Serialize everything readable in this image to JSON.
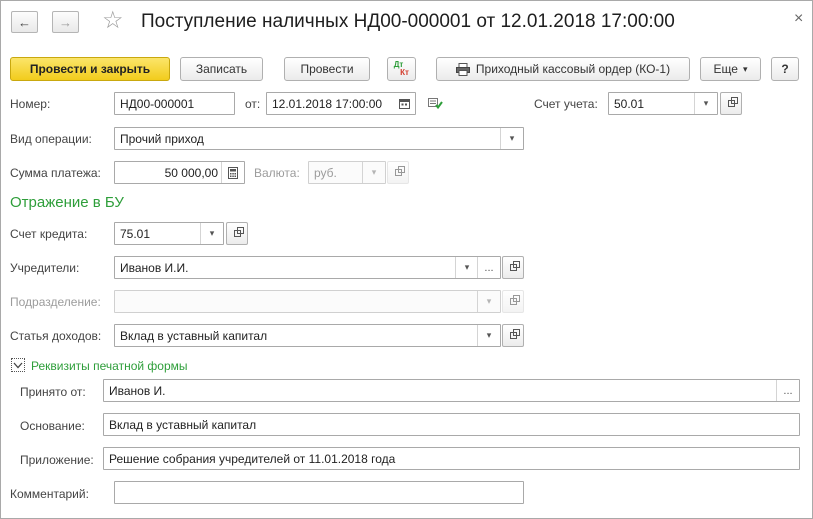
{
  "window": {
    "title": "Поступление наличных НД00-000001 от 12.01.2018 17:00:00",
    "close_glyph": "×"
  },
  "nav": {
    "back": "←",
    "forward": "→",
    "star": "☆"
  },
  "toolbar": {
    "post_close": "Провести и закрыть",
    "save": "Записать",
    "post": "Провести",
    "dt_kt_top": "Дт",
    "dt_kt_bottom": "Кт",
    "print_order": "Приходный кассовый ордер (КО-1)",
    "more": "Еще",
    "more_arrow": "▾",
    "help": "?"
  },
  "form": {
    "number_label": "Номер:",
    "number_value": "НД00-000001",
    "date_label": "от:",
    "date_value": "12.01.2018 17:00:00",
    "account_label": "Счет учета:",
    "account_value": "50.01",
    "operation_label": "Вид операции:",
    "operation_value": "Прочий приход",
    "amount_label": "Сумма платежа:",
    "amount_value": "50 000,00",
    "currency_label": "Валюта:",
    "currency_value": "руб."
  },
  "bu_section": {
    "title": "Отражение в БУ",
    "credit_account_label": "Счет кредита:",
    "credit_account_value": "75.01",
    "founders_label": "Учредители:",
    "founders_value": "Иванов И.И.",
    "division_label": "Подразделение:",
    "division_value": "",
    "income_item_label": "Статья доходов:",
    "income_item_value": "Вклад в уставный капитал"
  },
  "print_section": {
    "title": "Реквизиты печатной формы",
    "received_from_label": "Принято от:",
    "received_from_value": "Иванов И.",
    "basis_label": "Основание:",
    "basis_value": "Вклад в уставный капитал",
    "attachment_label": "Приложение:",
    "attachment_value": "Решение собрания учредителей от 11.01.2018 года"
  },
  "comment": {
    "label": "Комментарий:",
    "value": ""
  },
  "glyphs": {
    "dropdown": "▾",
    "ellipsis": "...",
    "check": "✓"
  },
  "colors": {
    "primary_button": "#f2cc1c",
    "section_title": "#2e9e3a"
  }
}
